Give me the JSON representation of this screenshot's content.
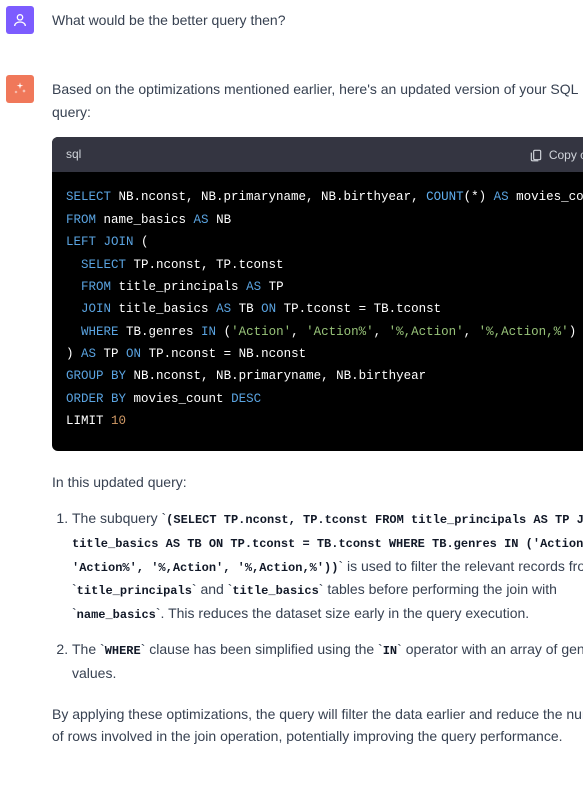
{
  "user_message": "What would be the better query then?",
  "ai_intro": "Based on the optimizations mentioned earlier, here's an updated version of your SQL query:",
  "code": {
    "lang": "sql",
    "copy_label": "Copy code",
    "tokens": [
      [
        [
          "kw",
          "SELECT"
        ],
        [
          "plain",
          " NB.nconst, NB.primaryname, NB.birthyear, "
        ],
        [
          "fn",
          "COUNT"
        ],
        [
          "plain",
          "("
        ],
        [
          "plain",
          "*"
        ],
        [
          "plain",
          ") "
        ],
        [
          "kw",
          "AS"
        ],
        [
          "plain",
          " movies_count"
        ]
      ],
      [
        [
          "kw",
          "FROM"
        ],
        [
          "plain",
          " name_basics "
        ],
        [
          "kw",
          "AS"
        ],
        [
          "plain",
          " NB"
        ]
      ],
      [
        [
          "kw",
          "LEFT"
        ],
        [
          "plain",
          " "
        ],
        [
          "kw",
          "JOIN"
        ],
        [
          "plain",
          " ("
        ]
      ],
      [
        [
          "plain",
          "  "
        ],
        [
          "kw",
          "SELECT"
        ],
        [
          "plain",
          " TP.nconst, TP.tconst"
        ]
      ],
      [
        [
          "plain",
          "  "
        ],
        [
          "kw",
          "FROM"
        ],
        [
          "plain",
          " title_principals "
        ],
        [
          "kw",
          "AS"
        ],
        [
          "plain",
          " TP"
        ]
      ],
      [
        [
          "plain",
          "  "
        ],
        [
          "kw",
          "JOIN"
        ],
        [
          "plain",
          " title_basics "
        ],
        [
          "kw",
          "AS"
        ],
        [
          "plain",
          " TB "
        ],
        [
          "kw",
          "ON"
        ],
        [
          "plain",
          " TP.tconst = TB.tconst"
        ]
      ],
      [
        [
          "plain",
          "  "
        ],
        [
          "kw",
          "WHERE"
        ],
        [
          "plain",
          " TB.genres "
        ],
        [
          "kw",
          "IN"
        ],
        [
          "plain",
          " ("
        ],
        [
          "str",
          "'Action'"
        ],
        [
          "plain",
          ", "
        ],
        [
          "str",
          "'Action%'"
        ],
        [
          "plain",
          ", "
        ],
        [
          "str",
          "'%,Action'"
        ],
        [
          "plain",
          ", "
        ],
        [
          "str",
          "'%,Action,%'"
        ],
        [
          "plain",
          ")"
        ]
      ],
      [
        [
          "plain",
          ") "
        ],
        [
          "kw",
          "AS"
        ],
        [
          "plain",
          " TP "
        ],
        [
          "kw",
          "ON"
        ],
        [
          "plain",
          " TP.nconst = NB.nconst"
        ]
      ],
      [
        [
          "kw",
          "GROUP"
        ],
        [
          "plain",
          " "
        ],
        [
          "kw",
          "BY"
        ],
        [
          "plain",
          " NB.nconst, NB.primaryname, NB.birthyear"
        ]
      ],
      [
        [
          "kw",
          "ORDER"
        ],
        [
          "plain",
          " "
        ],
        [
          "kw",
          "BY"
        ],
        [
          "plain",
          " movies_count "
        ],
        [
          "kw",
          "DESC"
        ]
      ],
      [
        [
          "plain",
          "LIMIT "
        ],
        [
          "num",
          "10"
        ]
      ]
    ]
  },
  "explain_heading": "In this updated query:",
  "explain_items": [
    {
      "prefix": "The subquery `",
      "code1": "(SELECT TP.nconst, TP.tconst FROM title_principals AS TP JOIN title_basics AS TB ON TP.tconst = TB.tconst WHERE TB.genres IN ('Action', 'Action%', '%,Action', '%,Action,%'))",
      "mid1": "` is used to filter the relevant records from `",
      "code2": "title_principals",
      "mid2": "` and `",
      "code3": "title_basics",
      "suffix": "` tables before performing the join with `",
      "code4": "name_basics",
      "tail": "`. This reduces the dataset size early in the query execution."
    },
    {
      "prefix": "The `",
      "code1": "WHERE",
      "mid1": "` clause has been simplified using the `",
      "code2": "IN",
      "suffix": "` operator with an array of genre values."
    }
  ],
  "closing": "By applying these optimizations, the query will filter the data earlier and reduce the number of rows involved in the join operation, potentially improving the query performance."
}
